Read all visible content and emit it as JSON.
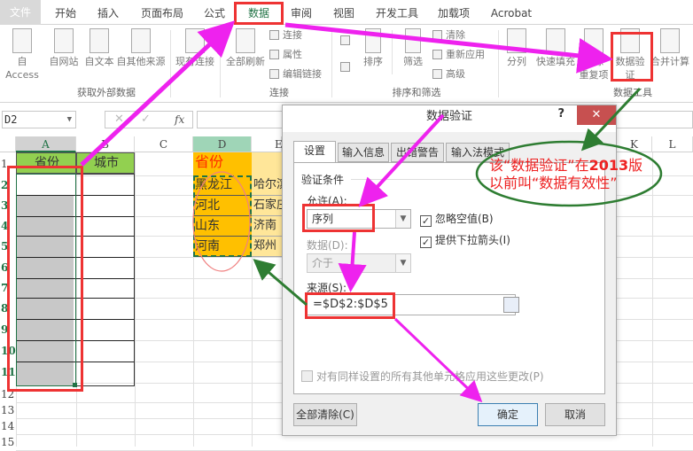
{
  "ribbon": {
    "tabs": [
      {
        "label": "文件",
        "active": false
      },
      {
        "label": "开始",
        "active": false
      },
      {
        "label": "插入",
        "active": false
      },
      {
        "label": "页面布局",
        "active": false
      },
      {
        "label": "公式",
        "active": false
      },
      {
        "label": "数据",
        "active": true
      },
      {
        "label": "审阅",
        "active": false
      },
      {
        "label": "视图",
        "active": false
      },
      {
        "label": "开发工具",
        "active": false
      },
      {
        "label": "加载项",
        "active": false
      },
      {
        "label": "Acrobat",
        "active": false
      }
    ],
    "groups": {
      "external": {
        "label": "获取外部数据",
        "buttons": [
          "自 Access",
          "自网站",
          "自文本",
          "自其他来源",
          "现有连接"
        ]
      },
      "connections": {
        "label": "连接",
        "refresh_all": "全部刷新",
        "items": [
          "连接",
          "属性",
          "编辑链接"
        ]
      },
      "sort_filter": {
        "label": "排序和筛选",
        "sort": "排序",
        "filter": "筛选",
        "items": [
          "清除",
          "重新应用",
          "高级"
        ]
      },
      "data_tools": {
        "label": "数据工具",
        "buttons": [
          "分列",
          "快速填充",
          "删除\n重复项",
          "数据验\n证",
          "合并计算"
        ],
        "split": "分列",
        "flash_fill": "快速填充",
        "remove_dup_1": "删除",
        "remove_dup_2": "重复项",
        "validation_1": "数据验",
        "validation_2": "证",
        "consolidate": "合并计算"
      }
    }
  },
  "formula_bar": {
    "name_box": "D2",
    "fx": "fx",
    "cancel": "✕",
    "enter": "✓",
    "value": ""
  },
  "sheet": {
    "columns": [
      "A",
      "B",
      "C",
      "D",
      "E",
      "K",
      "L"
    ],
    "rows": [
      "1",
      "2",
      "3",
      "4",
      "5",
      "6",
      "7",
      "8",
      "9",
      "10",
      "11",
      "12",
      "13",
      "14",
      "15"
    ],
    "a1": "省份",
    "b1": "城市",
    "d1": "省份",
    "d_values": [
      "黑龙江",
      "河北",
      "山东",
      "河南"
    ],
    "e_values": [
      "哈尔滨",
      "石家庄",
      "济南",
      "郑州"
    ]
  },
  "dialog": {
    "title": "数据验证",
    "help": "?",
    "close": "✕",
    "tabs": [
      "设置",
      "输入信息",
      "出错警告",
      "输入法模式"
    ],
    "section": "验证条件",
    "allow_label": "允许(A):",
    "allow_value": "序列",
    "ignore_blank": {
      "label": "忽略空值(B)",
      "checked": true
    },
    "in_cell_dropdown": {
      "label": "提供下拉箭头(I)",
      "checked": true
    },
    "data_label": "数据(D):",
    "data_value": "介于",
    "source_label": "来源(S):",
    "source_value": "=$D$2:$D$5",
    "apply_all": {
      "label": "对有同样设置的所有其他单元格应用这些更改(P)",
      "checked": false
    },
    "clear_all": "全部清除(C)",
    "ok": "确定",
    "cancel": "取消"
  },
  "annotation": {
    "line1_a": "该“数据验证”在",
    "line1_b": "2013",
    "line1_c": "版",
    "line2": "以前叫“数据有效性”"
  },
  "colors": {
    "accent": "#217346",
    "header_green": "#92d050",
    "orange": "#ffc000",
    "light_orange": "#ffe699",
    "highlight_red": "#ee3333",
    "arrow_magenta": "#ee22ee",
    "arrow_green": "#2e7d32"
  }
}
